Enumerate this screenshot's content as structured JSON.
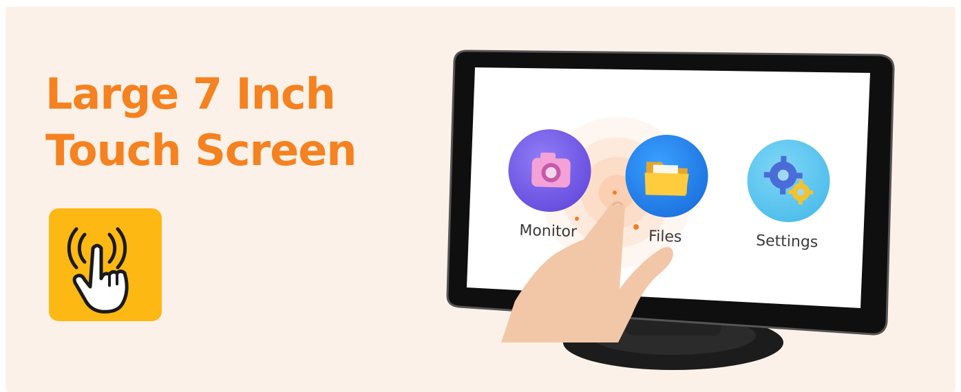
{
  "headline": {
    "line1": "Large 7 Inch",
    "line2": "Touch Screen"
  },
  "badge": {
    "icon": "touch-hand-icon"
  },
  "screen": {
    "apps": [
      {
        "label": "Monitor",
        "icon": "camera-icon"
      },
      {
        "label": "Files",
        "icon": "folder-icon"
      },
      {
        "label": "Settings",
        "icon": "gear-icon"
      }
    ]
  },
  "colors": {
    "headline": "#f58220",
    "badge": "#fdb813",
    "background": "#fcf1e8"
  }
}
